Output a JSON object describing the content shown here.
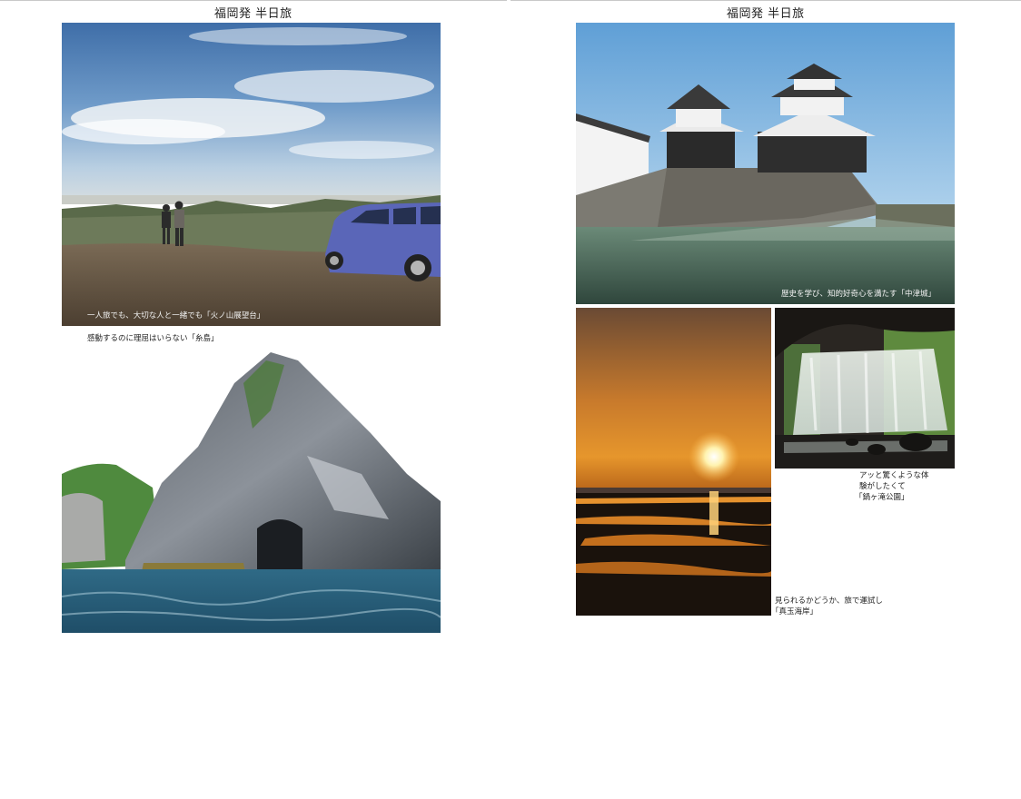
{
  "left_page": {
    "header": "福岡発 半日旅",
    "photo_1": {
      "caption": "一人旅でも、大切な人と一緒でも「火ノ山展望台」"
    },
    "photo_2": {
      "caption": "感動するのに理屈はいらない「糸島」"
    }
  },
  "right_page": {
    "header": "福岡発 半日旅",
    "photo_castle": {
      "caption": "歴史を学び、知的好奇心を満たす「中津城」"
    },
    "photo_waterfall": {
      "caption_lines": [
        "アッと驚くような体",
        "験がしたくて",
        "「鍋ヶ滝公園」"
      ]
    },
    "photo_sunset": {
      "caption_lines": [
        "見られるかどうか、旅で運試し",
        "「真玉海岸」"
      ]
    }
  }
}
